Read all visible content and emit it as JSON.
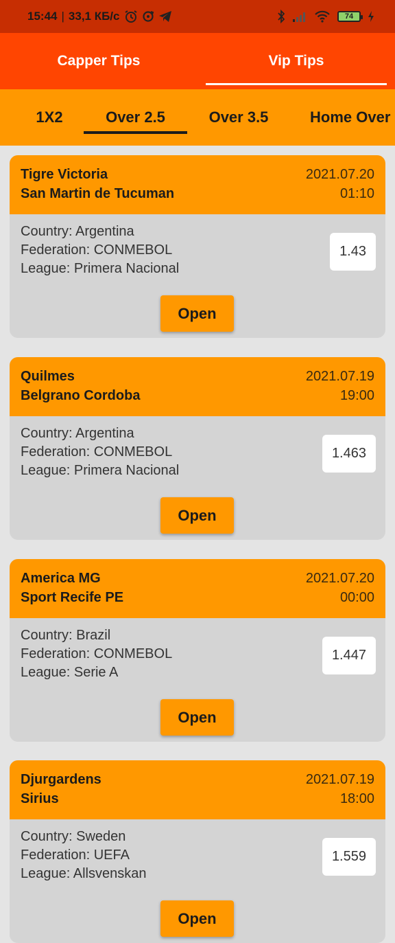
{
  "status_bar": {
    "time": "15:44",
    "separator": "|",
    "net_speed": "33,1 КБ/с",
    "battery": "74"
  },
  "top_tabs": [
    {
      "label": "Capper Tips",
      "active": false
    },
    {
      "label": "Vip Tips",
      "active": true
    }
  ],
  "sub_tabs": [
    {
      "label": "1X2",
      "active": false
    },
    {
      "label": "Over 2.5",
      "active": true
    },
    {
      "label": "Over 3.5",
      "active": false
    },
    {
      "label": "Home Over",
      "active": false
    }
  ],
  "tips": [
    {
      "home": "Tigre Victoria",
      "away": "San Martin de Tucuman",
      "date": "2021.07.20",
      "time": "01:10",
      "country": "Country: Argentina",
      "federation": "Federation: CONMEBOL",
      "league": "League: Primera Nacional",
      "odds": "1.43",
      "button": "Open"
    },
    {
      "home": "Quilmes",
      "away": "Belgrano Cordoba",
      "date": "2021.07.19",
      "time": "19:00",
      "country": "Country: Argentina",
      "federation": "Federation: CONMEBOL",
      "league": "League: Primera Nacional",
      "odds": "1.463",
      "button": "Open"
    },
    {
      "home": "America MG",
      "away": "Sport Recife PE",
      "date": "2021.07.20",
      "time": "00:00",
      "country": "Country: Brazil",
      "federation": "Federation: CONMEBOL",
      "league": "League: Serie A",
      "odds": "1.447",
      "button": "Open"
    },
    {
      "home": "Djurgardens",
      "away": "Sirius",
      "date": "2021.07.19",
      "time": "18:00",
      "country": "Country: Sweden",
      "federation": "Federation: UEFA",
      "league": "League: Allsvenskan",
      "odds": "1.559",
      "button": "Open"
    }
  ],
  "colors": {
    "status_bar": "#c72e02",
    "top_bar": "#ff4501",
    "accent": "#ff9800",
    "card_body": "#d4d4d4",
    "background": "#e4e4e4"
  },
  "icons": [
    "alarm-icon",
    "sync-icon",
    "telegram-icon",
    "bluetooth-icon",
    "signal-icon",
    "wifi-icon",
    "battery-icon",
    "charging-icon"
  ]
}
